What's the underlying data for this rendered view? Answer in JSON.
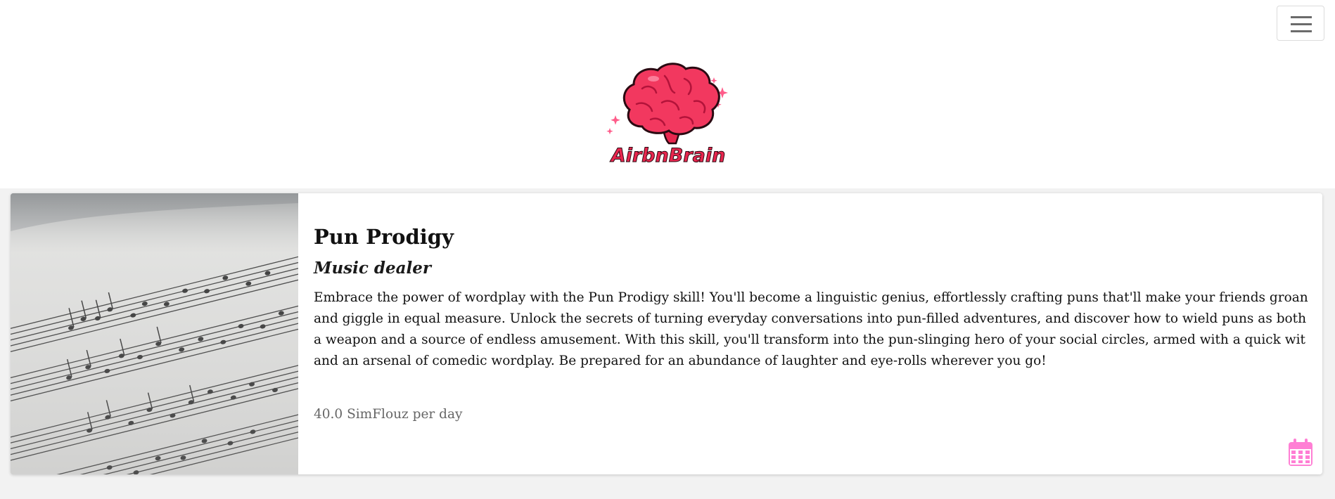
{
  "header": {
    "brand_name": "AirbnBrain",
    "menu_toggle_icon": "hamburger-menu-icon"
  },
  "skill": {
    "title": "Pun Prodigy",
    "category": "Music dealer",
    "description": "Embrace the power of wordplay with the Pun Prodigy skill! You'll become a linguistic genius, effortlessly crafting puns that'll make your friends groan and giggle in equal measure. Unlock the secrets of turning everyday conversations into pun-filled adventures, and discover how to wield puns as both a weapon and a source of endless amusement. With this skill, you'll transform into the pun-slinging hero of your social circles, armed with a quick wit and an arsenal of comedic wordplay. Be prepared for an abundance of laughter and eye-rolls wherever you go!",
    "price": "40.0 SimFlouz per day",
    "image_subject": "sheet-music-photo",
    "booking_icon": "calendar-icon"
  },
  "colors": {
    "brand": "#e8264e",
    "calendar_accent": "#ff7fd4",
    "page_background": "#f2f2f2"
  }
}
